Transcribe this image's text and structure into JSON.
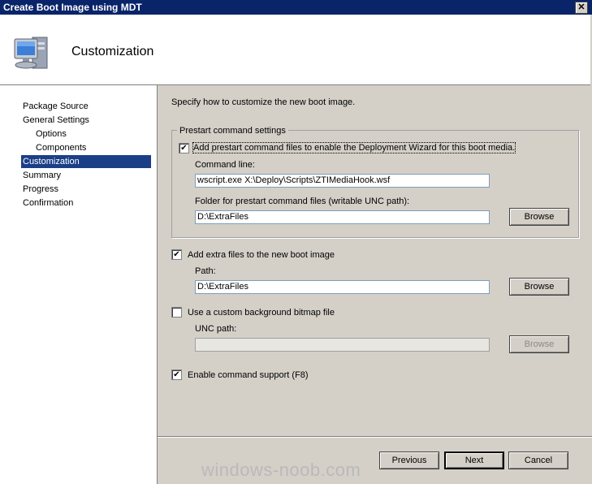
{
  "window": {
    "title": "Create Boot Image using MDT",
    "close_glyph": "✕"
  },
  "header": {
    "title": "Customization",
    "icon": "computer-icon"
  },
  "sidebar": {
    "items": [
      {
        "label": "Package Source"
      },
      {
        "label": "General Settings"
      },
      {
        "label": "Options"
      },
      {
        "label": "Components"
      },
      {
        "label": "Customization"
      },
      {
        "label": "Summary"
      },
      {
        "label": "Progress"
      },
      {
        "label": "Confirmation"
      }
    ],
    "active": "Customization"
  },
  "main": {
    "instructions": "Specify how to customize the new boot image.",
    "prestart": {
      "group_label": "Prestart command settings",
      "checkbox_label": "Add prestart command files to enable the Deployment Wizard for this boot media.",
      "checked": true,
      "command_line_label": "Command line:",
      "command_line_value": "wscript.exe X:\\Deploy\\Scripts\\ZTIMediaHook.wsf",
      "folder_label": "Folder for prestart command files (writable UNC path):",
      "folder_value": "D:\\ExtraFiles",
      "browse_label": "Browse"
    },
    "extra_files": {
      "checkbox_label": "Add extra files to the new boot image",
      "checked": true,
      "path_label": "Path:",
      "path_value": "D:\\ExtraFiles",
      "browse_label": "Browse"
    },
    "background": {
      "checkbox_label": "Use a custom background bitmap file",
      "checked": false,
      "unc_label": "UNC path:",
      "unc_value": "",
      "browse_label": "Browse"
    },
    "command_support": {
      "checkbox_label": "Enable command support (F8)",
      "checked": true
    }
  },
  "footer": {
    "previous": "Previous",
    "next": "Next",
    "cancel": "Cancel"
  },
  "watermark": "windows-noob.com",
  "colors": {
    "titlebar": "#0a246a",
    "selection": "#1b3f87",
    "dialog_bg": "#d4d0c8"
  }
}
